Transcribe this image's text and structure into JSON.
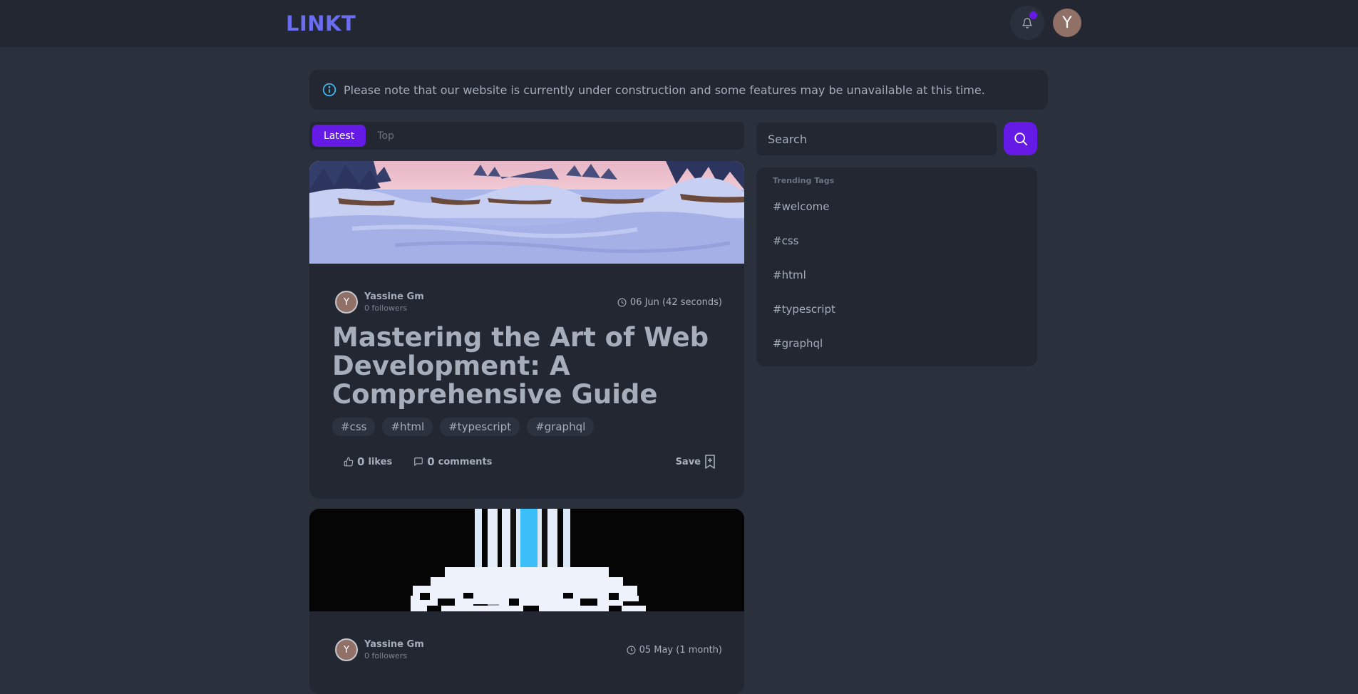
{
  "app": {
    "logo": "LINKT",
    "user_initial": "Y"
  },
  "notice": {
    "text": "Please note that our website is currently under construction and some features may be unavailable at this time."
  },
  "tabs": [
    {
      "label": "Latest",
      "active": true
    },
    {
      "label": "Top",
      "active": false
    }
  ],
  "search": {
    "placeholder": "Search"
  },
  "trending": {
    "title": "Trending Tags",
    "tags": [
      "#welcome",
      "#css",
      "#html",
      "#typescript",
      "#graphql"
    ]
  },
  "posts": [
    {
      "author": "Yassine Gm",
      "author_initial": "Y",
      "followers": "0 followers",
      "date": "06 Jun (42 seconds)",
      "title": "Mastering the Art of Web Development: A Comprehensive Guide",
      "tags": [
        "#css",
        "#html",
        "#typescript",
        "#graphql"
      ],
      "likes_count": "0",
      "likes_label": "likes",
      "comments_count": "0",
      "comments_label": "comments",
      "save_label": "Save"
    },
    {
      "author": "Yassine Gm",
      "author_initial": "Y",
      "followers": "0 followers",
      "date": "05 May (1 month)"
    }
  ],
  "colors": {
    "accent": "#661ae6",
    "logo": "#6a6df0",
    "background": "#2a303c",
    "surface": "#222731",
    "info": "#3abff8"
  },
  "icons": [
    "bell-icon",
    "info-icon",
    "search-icon",
    "clock-icon",
    "thumbs-up-icon",
    "comment-icon",
    "bookmark-icon"
  ]
}
